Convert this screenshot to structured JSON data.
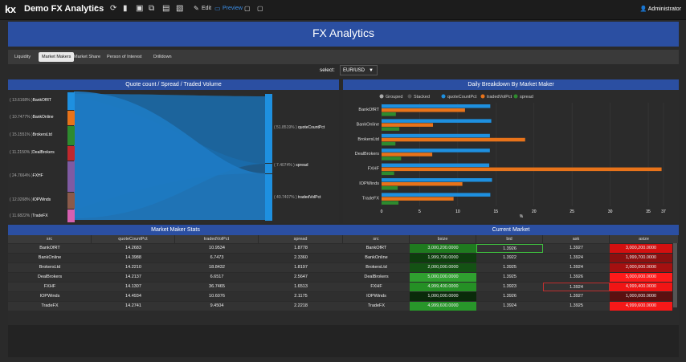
{
  "topbar": {
    "logo": "kx",
    "app_title": "Demo FX Analytics",
    "edit_label": "Edit",
    "preview_label": "Preview",
    "user": "Administrator"
  },
  "banner": {
    "title": "FX Analytics"
  },
  "tabs": [
    {
      "label": "Liquidity"
    },
    {
      "label": "Market Makers"
    },
    {
      "label": "Market Share"
    },
    {
      "label": "Person of Interest"
    },
    {
      "label": "Drilldown"
    }
  ],
  "selector": {
    "label": "select:",
    "value": "EUR/USD"
  },
  "sankey": {
    "title": "Quote count / Spread / Traded Volume",
    "left_nodes": [
      {
        "pct": "( 13.6168% )",
        "name": "BankOfRT",
        "color": "#1e90e0"
      },
      {
        "pct": "( 10.7477% )",
        "name": "BankOnline",
        "color": "#e8731a"
      },
      {
        "pct": "( 15.1551% )",
        "name": "BrokersLtd",
        "color": "#2e8b2e"
      },
      {
        "pct": "( 11.2150% )",
        "name": "DealBrokers",
        "color": "#c0282d"
      },
      {
        "pct": "( 24.7664% )",
        "name": "FXHF",
        "color": "#7f5aa2"
      },
      {
        "pct": "( 12.0268% )",
        "name": "IOPWinds",
        "color": "#8b5a4a"
      },
      {
        "pct": "( 11.6822% )",
        "name": "TradeFX",
        "color": "#d660b0"
      }
    ],
    "right_nodes": [
      {
        "pct": "( 51.8519% )",
        "name": "quoteCountPct"
      },
      {
        "pct": "( 7.4074% )",
        "name": "spread"
      },
      {
        "pct": "( 40.7407% )",
        "name": "tradedVolPct"
      }
    ]
  },
  "breakdown": {
    "title": "Daily Breakdown By Market Maker",
    "modes": [
      "Grouped",
      "Stacked"
    ],
    "legend": [
      {
        "name": "quoteCountPct",
        "color": "#1e90e0"
      },
      {
        "name": "tradedVolPct",
        "color": "#e8731a"
      },
      {
        "name": "spread",
        "color": "#2e8b2e"
      }
    ]
  },
  "chart_data": {
    "type": "bar",
    "orientation": "horizontal",
    "categories": [
      "BankOfRT",
      "BankOnline",
      "BrokersLtd",
      "DealBrokers",
      "FXHF",
      "IOPWinds",
      "TradeFX"
    ],
    "series": [
      {
        "name": "quoteCountPct",
        "values": [
          14.2683,
          14.3988,
          14.221,
          14.2137,
          14.1307,
          14.4934,
          14.2741
        ]
      },
      {
        "name": "tradedVolPct",
        "values": [
          10.9534,
          6.7473,
          18.8432,
          6.6517,
          36.7465,
          10.6076,
          9.4504
        ]
      },
      {
        "name": "spread",
        "values": [
          1.8778,
          2.336,
          1.8197,
          2.5647,
          1.6513,
          2.1175,
          2.2218
        ]
      }
    ],
    "xticks": [
      "0",
      "5",
      "10",
      "15",
      "20",
      "25",
      "30",
      "35",
      "37"
    ],
    "xlim": [
      0,
      37
    ],
    "xlabel": "%"
  },
  "stats": {
    "title": "Market Maker Stats",
    "columns": [
      "src",
      "quoteCountPct",
      "tradedVolPct",
      "spread"
    ],
    "rows": [
      [
        "BankOfRT",
        "14.2683",
        "10.9534",
        "1.8778"
      ],
      [
        "BankOnline",
        "14.3988",
        "6.7473",
        "2.3360"
      ],
      [
        "BrokersLtd",
        "14.2210",
        "18.8432",
        "1.8197"
      ],
      [
        "DealBrokers",
        "14.2137",
        "6.6517",
        "2.5647"
      ],
      [
        "FXHF",
        "14.1307",
        "36.7465",
        "1.6513"
      ],
      [
        "IOPWinds",
        "14.4934",
        "10.6076",
        "2.1175"
      ],
      [
        "TradeFX",
        "14.2741",
        "9.4504",
        "2.2218"
      ]
    ]
  },
  "market": {
    "title": "Current Market",
    "columns": [
      "src",
      "bsize",
      "bid",
      "ask",
      "asize"
    ],
    "rows": [
      [
        "BankOfRT",
        "3,000,200.0000",
        "1.3926",
        "1.3927",
        "3,000,200.0000"
      ],
      [
        "BankOnline",
        "1,999,700.0000",
        "1.3922",
        "1.3924",
        "1,999,700.0000"
      ],
      [
        "BrokersLtd",
        "2,000,000.0000",
        "1.3925",
        "1.3924",
        "2,000,000.0000"
      ],
      [
        "DealBrokers",
        "5,000,000.0000",
        "1.3925",
        "1.3926",
        "5,000,000.0000"
      ],
      [
        "FXHF",
        "4,999,400.0000",
        "1.3923",
        "1.3924",
        "4,999,400.0000"
      ],
      [
        "IOPWinds",
        "1,000,000.0000",
        "1.3926",
        "1.3927",
        "1,000,000.0000"
      ],
      [
        "TradeFX",
        "4,999,600.0000",
        "1.3924",
        "1.3925",
        "4,999,600.0000"
      ]
    ],
    "bsize_colors": [
      "#1f7a1f",
      "#0d3d0d",
      "#145214",
      "#2fa02f",
      "#259025",
      "#0a2a0a",
      "#28962a"
    ],
    "asize_colors": [
      "#d41010",
      "#8a1010",
      "#a51010",
      "#ff1a1a",
      "#f01515",
      "#5a1010",
      "#f51818"
    ]
  }
}
